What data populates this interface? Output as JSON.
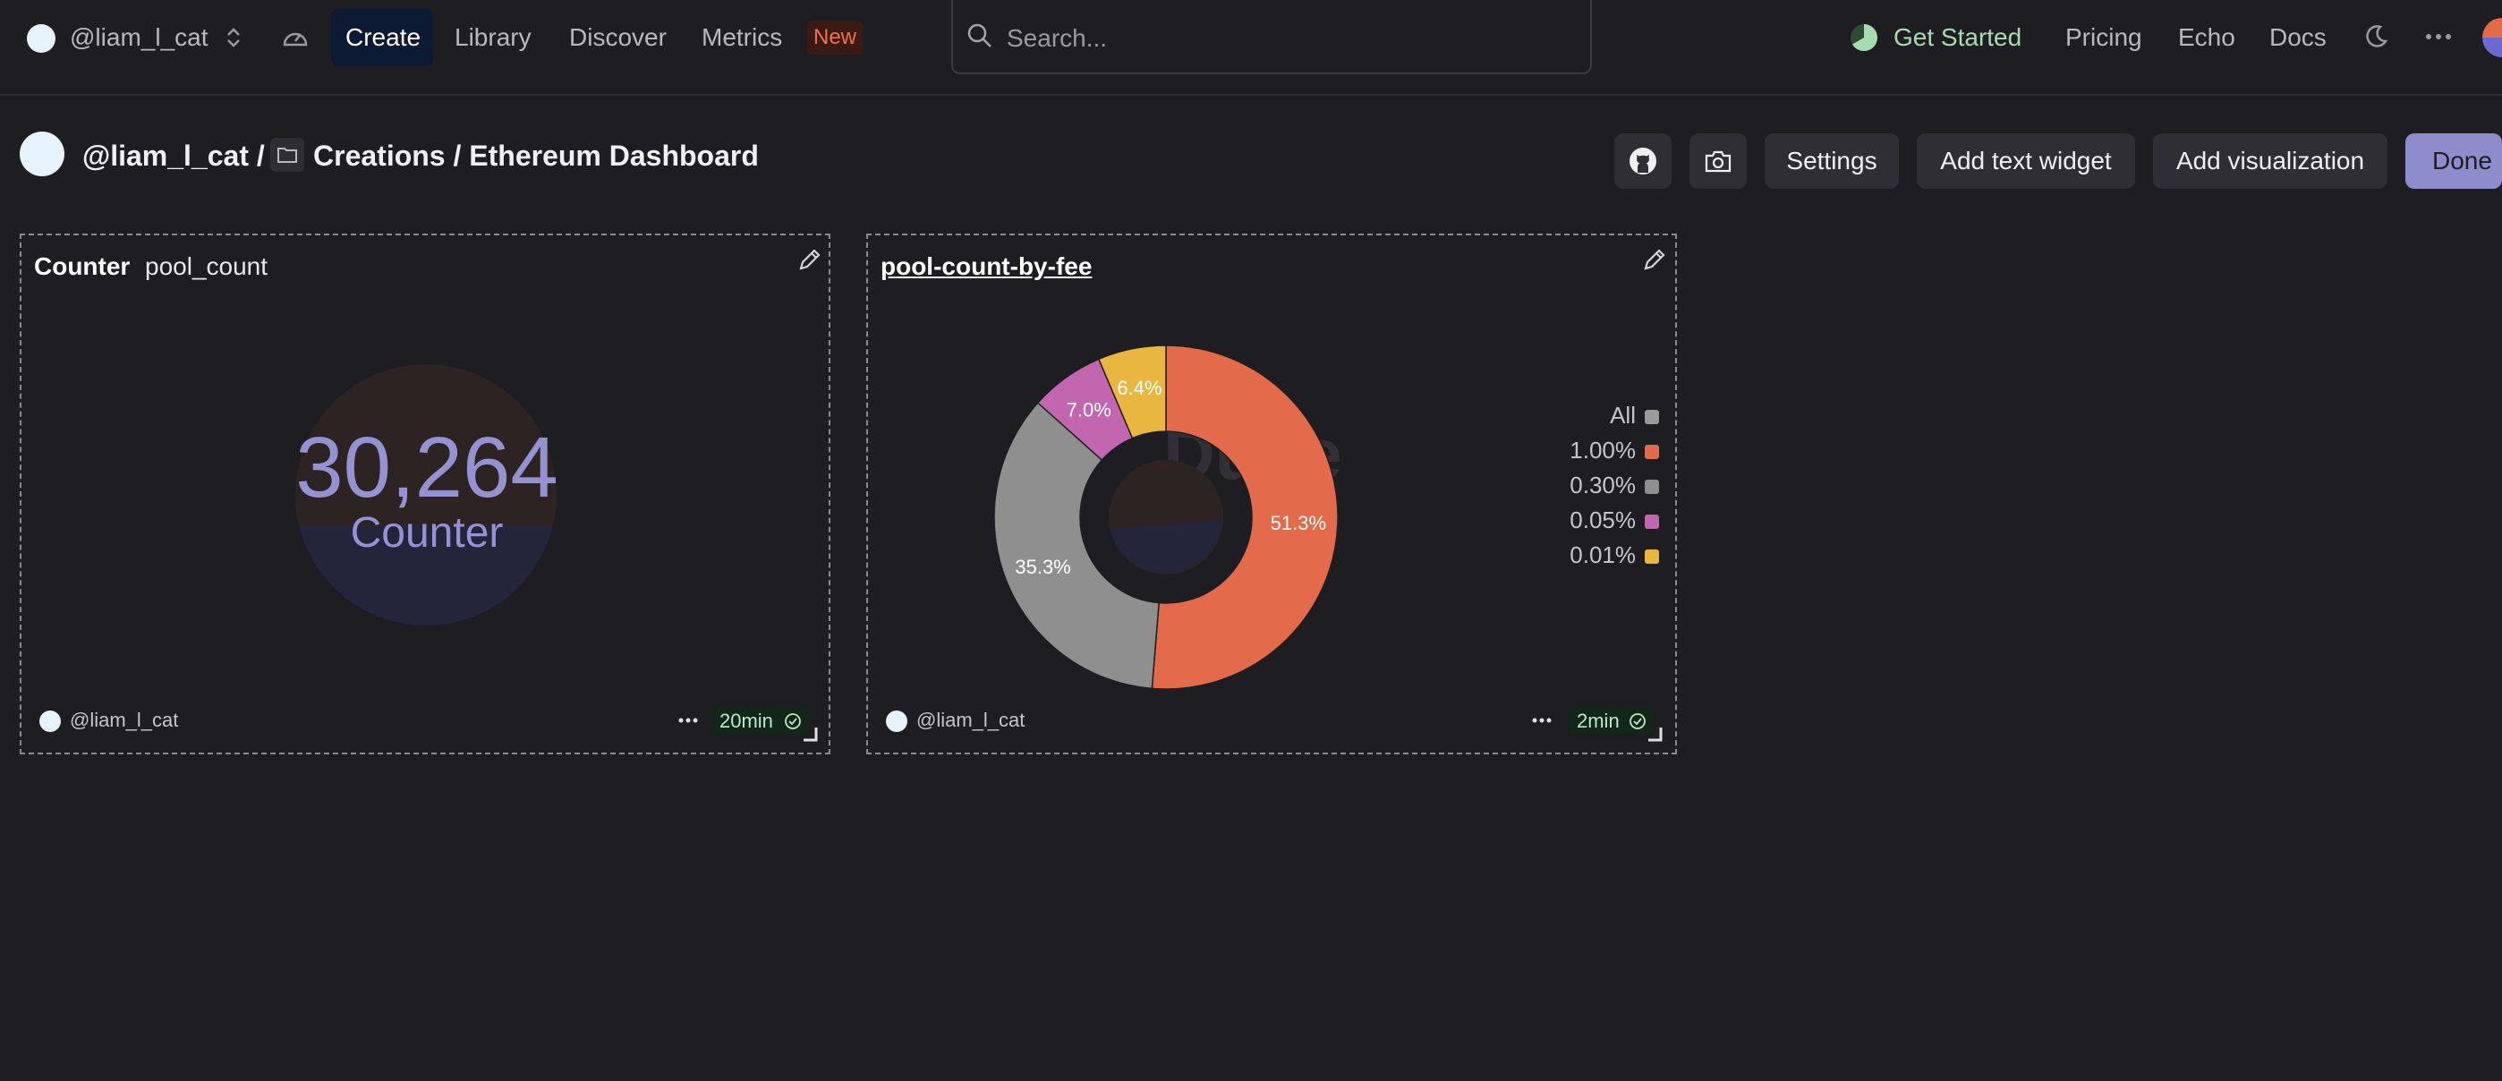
{
  "nav": {
    "user": "@liam_l_cat",
    "items": [
      "Create",
      "Library",
      "Discover",
      "Metrics"
    ],
    "new_badge": "New",
    "search_placeholder": "Search...",
    "get_started": "Get Started",
    "right_links": [
      "Pricing",
      "Echo",
      "Docs"
    ]
  },
  "header": {
    "user_crumb": "@liam_l_cat /",
    "path": "Creations / Ethereum Dashboard",
    "buttons": {
      "settings": "Settings",
      "add_text_widget": "Add text widget",
      "add_visualization": "Add visualization",
      "done": "Done"
    }
  },
  "widgets": [
    {
      "type_label": "Counter",
      "query_name": "pool_count",
      "value": "30,264",
      "caption": "Counter",
      "owner": "@liam_l_cat",
      "refresh": "20min"
    },
    {
      "title": "pool-count-by-fee",
      "owner": "@liam_l_cat",
      "refresh": "2min",
      "watermark": "Dune"
    }
  ],
  "chart_data": {
    "type": "pie",
    "title": "pool-count-by-fee",
    "donut": true,
    "legend_position": "right",
    "legend": [
      {
        "label": "All",
        "color": "#9a9a9a"
      },
      {
        "label": "1.00%",
        "color": "#e36a4a"
      },
      {
        "label": "0.30%",
        "color": "#8f8f8f"
      },
      {
        "label": "0.05%",
        "color": "#c366b0"
      },
      {
        "label": "0.01%",
        "color": "#e9b73f"
      }
    ],
    "slices": [
      {
        "label": "1.00%",
        "value": 51.3,
        "text": "51.3%",
        "color": "#e36a4a"
      },
      {
        "label": "0.30%",
        "value": 35.3,
        "text": "35.3%",
        "color": "#8f8f8f"
      },
      {
        "label": "0.05%",
        "value": 7.0,
        "text": "7.0%",
        "color": "#c366b0"
      },
      {
        "label": "0.01%",
        "value": 6.4,
        "text": "6.4%",
        "color": "#e9b73f"
      }
    ]
  },
  "colors": {
    "background": "#1e1e22",
    "accent": "#8f8ccc",
    "counter_value": "#9592d2",
    "get_started": "#a8dcb0",
    "new_badge": "#f07050"
  },
  "icons": [
    "user-avatar",
    "chevron-updown-icon",
    "speedometer-icon",
    "search-icon",
    "progress-pie-icon",
    "moon-icon",
    "more-horizontal-icon",
    "folder-icon",
    "github-icon",
    "camera-icon",
    "pencil-icon",
    "check-circle-icon",
    "resize-handle-icon"
  ]
}
